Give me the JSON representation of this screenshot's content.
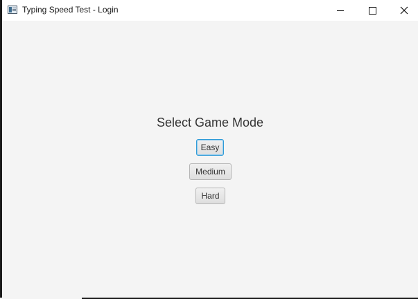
{
  "window": {
    "title": "Typing Speed Test - Login",
    "controls": {
      "minimize_icon": "minimize-icon",
      "maximize_icon": "maximize-icon",
      "close_icon": "close-icon"
    }
  },
  "main": {
    "heading": "Select Game Mode",
    "modes": [
      {
        "label": "Easy",
        "focused": true
      },
      {
        "label": "Medium",
        "focused": false
      },
      {
        "label": "Hard",
        "focused": false
      }
    ]
  },
  "colors": {
    "background": "#f4f4f4",
    "focus_border": "#2f9bd8",
    "text": "#333333"
  }
}
